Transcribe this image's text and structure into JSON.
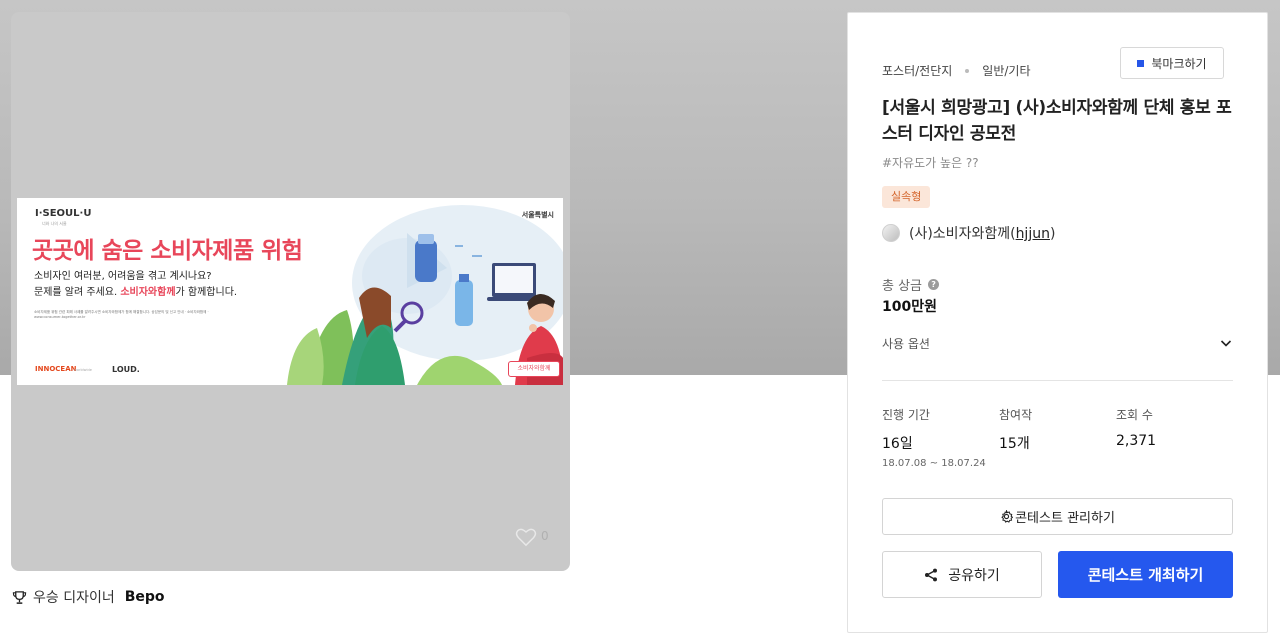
{
  "poster": {
    "brand_left": "I·SEOUL·U",
    "brand_left_sub": "너와 나의 서울",
    "brand_right": "서울특별시",
    "headline": "곳곳에 숨은 소비자제품 위험",
    "line1": "소비자인 여러분, 어려움을 겪고 계시나요?",
    "line2_pre": "문제를 알려 주세요.",
    "line2_org": "소비자와함께",
    "line2_post": "가 함께합니다.",
    "fine_print": "소비자제품 위험 관련 피해 사례를 알려주시면 소비자와함께가 함께 해결합니다. 상담문의 및 신고 안내 · 소비자와함께 · www.consumer-together.or.kr",
    "logo1": "INNOCEAN",
    "logo1_sub": "worldwide",
    "logo2": "LOUD.",
    "stamp": "소비자와함께"
  },
  "likes": {
    "count": "0"
  },
  "winner": {
    "label": "우승 디자이너",
    "name": "Bepo"
  },
  "panel": {
    "category": "포스터/전단지",
    "subcategory": "일반/기타",
    "bookmark_label": "북마크하기",
    "title": "[서울시 희망광고] (사)소비자와함께 단체 홍보 포스터 디자인 공모전",
    "hashtag": "#자유도가 높은 ??",
    "badge": "실속형",
    "host_name": "(사)소비자와함께",
    "host_id": "hjjun",
    "prize_label": "총 상금",
    "prize_value": "100만원",
    "usage_label": "사용 옵션",
    "stats": {
      "period_label": "진행 기간",
      "period_value": "16일",
      "period_range": "18.07.08 ~ 18.07.24",
      "entries_label": "참여작",
      "entries_value": "15개",
      "views_label": "조회 수",
      "views_value": "2,371"
    },
    "manage_label": "콘테스트 관리하기",
    "share_label": "공유하기",
    "host_contest_label": "콘테스트 개최하기"
  },
  "colors": {
    "accent": "#2558ee",
    "badge_bg": "#fbe6d9",
    "badge_text": "#d4652c",
    "headline": "#e8465a",
    "bookmark_icon": "#2656e8"
  },
  "icons": [
    "heart-icon",
    "trophy-icon",
    "bookmark-icon",
    "help-icon",
    "chevron-down-icon",
    "gear-icon",
    "share-icon"
  ]
}
